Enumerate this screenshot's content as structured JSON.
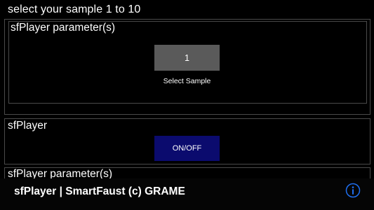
{
  "header": {
    "title": "select your sample 1 to 10"
  },
  "sections": [
    {
      "label": "sfPlayer parameter(s)",
      "sample_button": {
        "value": "1",
        "caption": "Select Sample"
      }
    },
    {
      "label": "sfPlayer",
      "toggle_button": {
        "label": "ON/OFF",
        "color": "#0b0b6e"
      }
    },
    {
      "label": "sfPlayer parameter(s)"
    }
  ],
  "footer": {
    "text": "sfPlayer | SmartFaust (c) GRAME",
    "icon": "info-icon",
    "icon_color": "#1e6ff0"
  }
}
